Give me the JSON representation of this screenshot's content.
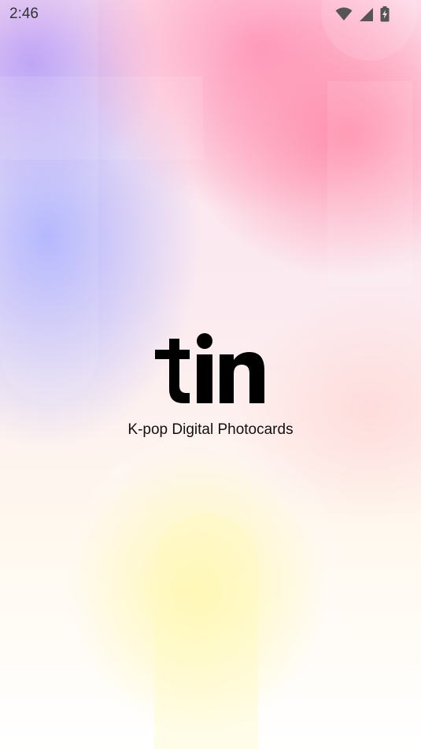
{
  "status_bar": {
    "time": "2:46",
    "icons": [
      "wifi-icon",
      "cellular-signal-icon",
      "battery-charging-icon"
    ]
  },
  "splash": {
    "logo_text": "tin",
    "tagline": "K-pop Digital Photocards"
  },
  "colors": {
    "logo": "#000000",
    "pink": "#ff8caa",
    "lavender": "#aab0ff",
    "yellow": "#fff8aa"
  }
}
